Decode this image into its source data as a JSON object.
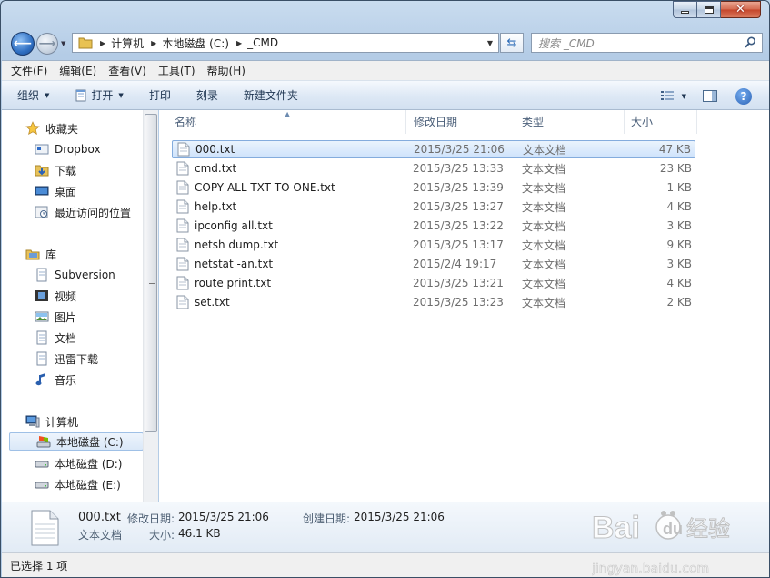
{
  "address": {
    "crumbs": [
      "计算机",
      "本地磁盘 (C:)",
      "_CMD"
    ]
  },
  "search": {
    "placeholder": "搜索 _CMD"
  },
  "menu": [
    "文件(F)",
    "编辑(E)",
    "查看(V)",
    "工具(T)",
    "帮助(H)"
  ],
  "commands": {
    "organize": "组织",
    "open": "打开",
    "print": "打印",
    "burn": "刻录",
    "new_folder": "新建文件夹"
  },
  "nav": {
    "favorites": {
      "label": "收藏夹",
      "items": [
        "Dropbox",
        "下载",
        "桌面",
        "最近访问的位置"
      ]
    },
    "libraries": {
      "label": "库",
      "items": [
        "Subversion",
        "视频",
        "图片",
        "文档",
        "迅雷下载",
        "音乐"
      ]
    },
    "computer": {
      "label": "计算机",
      "items": [
        "本地磁盘 (C:)",
        "本地磁盘 (D:)",
        "本地磁盘 (E:)"
      ]
    }
  },
  "columns": {
    "name": "名称",
    "date": "修改日期",
    "type": "类型",
    "size": "大小"
  },
  "files": [
    {
      "name": "000.txt",
      "date": "2015/3/25 21:06",
      "type": "文本文档",
      "size": "47 KB"
    },
    {
      "name": "cmd.txt",
      "date": "2015/3/25 13:33",
      "type": "文本文档",
      "size": "23 KB"
    },
    {
      "name": "COPY ALL TXT TO ONE.txt",
      "date": "2015/3/25 13:39",
      "type": "文本文档",
      "size": "1 KB"
    },
    {
      "name": "help.txt",
      "date": "2015/3/25 13:27",
      "type": "文本文档",
      "size": "4 KB"
    },
    {
      "name": "ipconfig all.txt",
      "date": "2015/3/25 13:22",
      "type": "文本文档",
      "size": "3 KB"
    },
    {
      "name": "netsh dump.txt",
      "date": "2015/3/25 13:17",
      "type": "文本文档",
      "size": "9 KB"
    },
    {
      "name": "netstat -an.txt",
      "date": "2015/2/4 19:17",
      "type": "文本文档",
      "size": "3 KB"
    },
    {
      "name": "route print.txt",
      "date": "2015/3/25 13:21",
      "type": "文本文档",
      "size": "4 KB"
    },
    {
      "name": "set.txt",
      "date": "2015/3/25 13:23",
      "type": "文本文档",
      "size": "2 KB"
    }
  ],
  "details": {
    "name": "000.txt",
    "type": "文本文档",
    "modified_label": "修改日期:",
    "modified": "2015/3/25 21:06",
    "created_label": "创建日期:",
    "created": "2015/3/25 21:06",
    "size_label": "大小:",
    "size": "46.1 KB"
  },
  "status": {
    "text": "已选择 1 项"
  },
  "watermark": {
    "brand": "Bai",
    "brand2": "经验",
    "url": "jingyan.baidu.com"
  },
  "colors": {
    "selection": "#cfe3fb",
    "selection_border": "#84acdd",
    "link": "#1e3551"
  }
}
